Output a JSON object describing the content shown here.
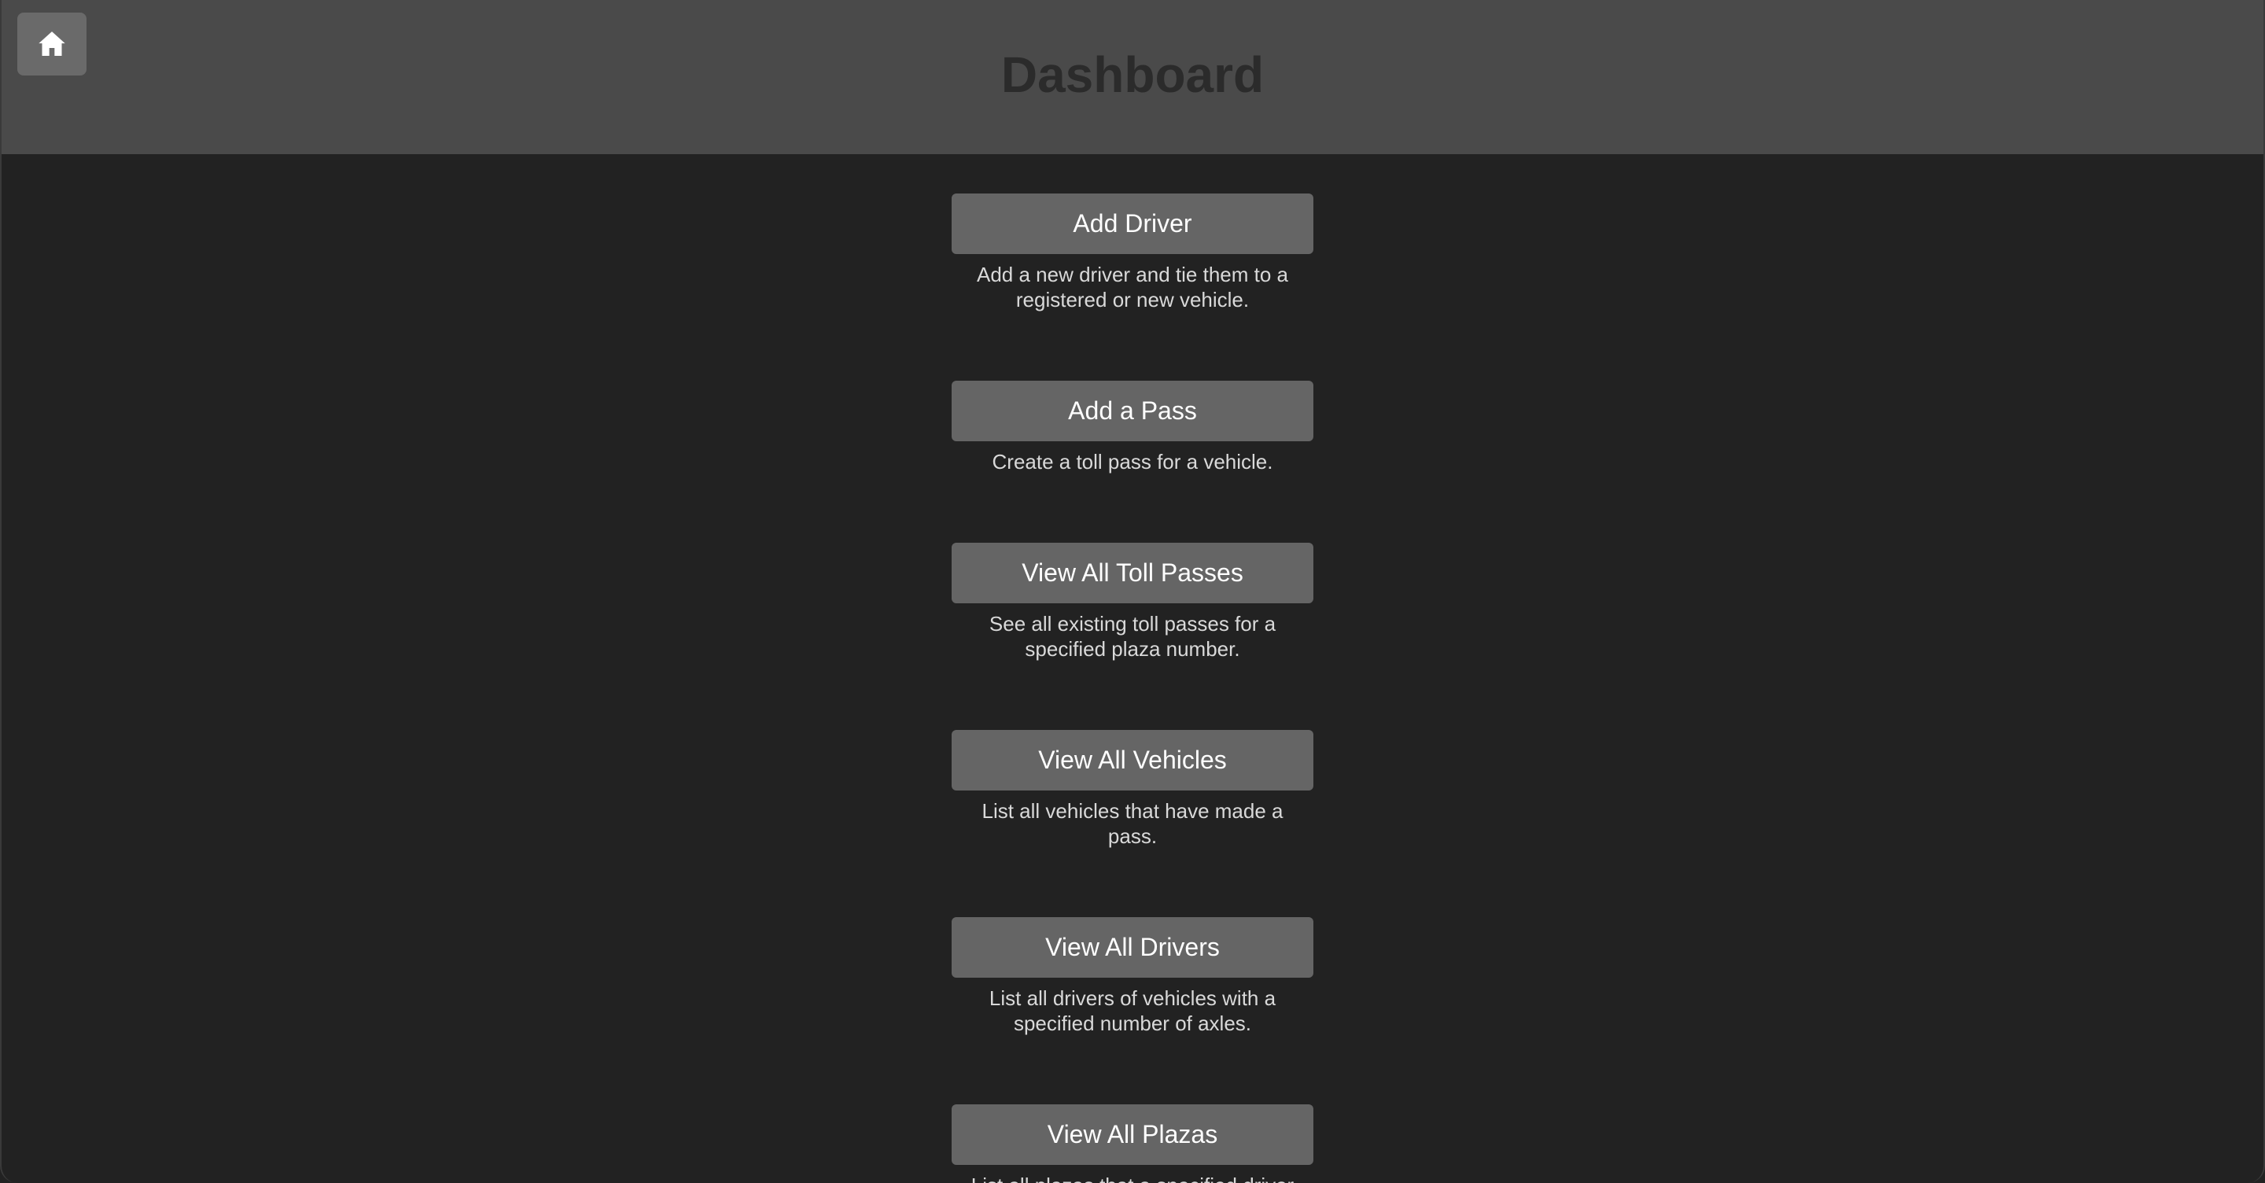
{
  "header": {
    "title": "Dashboard",
    "home_icon": "home-icon"
  },
  "actions": [
    {
      "label": "Add Driver",
      "description": "Add a new driver and tie them to a registered or new vehicle."
    },
    {
      "label": "Add a Pass",
      "description": "Create a toll pass for a vehicle."
    },
    {
      "label": "View All Toll Passes",
      "description": "See all existing toll passes for a specified plaza number."
    },
    {
      "label": "View All Vehicles",
      "description": "List all vehicles that have made a pass."
    },
    {
      "label": "View All Drivers",
      "description": "List all drivers of vehicles with a specified number of axles."
    },
    {
      "label": "View All Plazas",
      "description": "List all plazas that a specified driver"
    }
  ],
  "colors": {
    "background": "#222222",
    "header": "#4a4a4a",
    "button": "#656565",
    "title": "#2b2b2b"
  }
}
